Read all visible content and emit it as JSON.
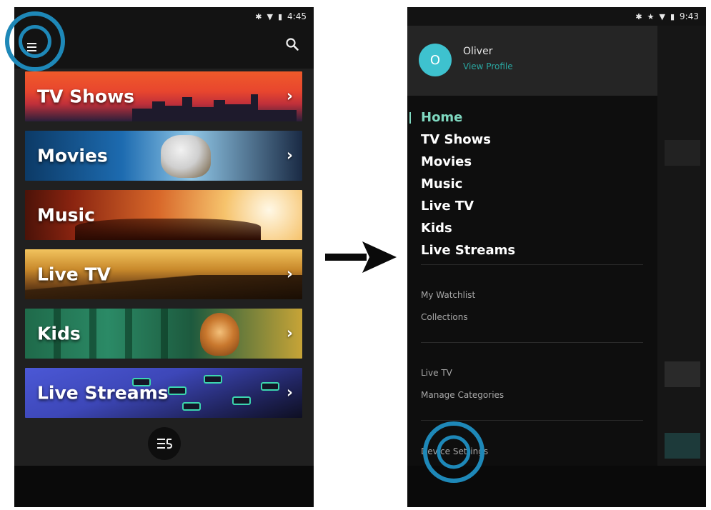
{
  "left_screen": {
    "status": {
      "time": "4:45",
      "icons": [
        "bluetooth-icon",
        "wifi-icon",
        "battery-icon"
      ]
    },
    "app_bar": {
      "icons": [
        "menu-icon",
        "search-icon"
      ]
    },
    "tiles": [
      {
        "label": "TV Shows",
        "chevron": "›"
      },
      {
        "label": "Movies",
        "chevron": "›"
      },
      {
        "label": "Music",
        "chevron": ""
      },
      {
        "label": "Live TV",
        "chevron": "›"
      },
      {
        "label": "Kids",
        "chevron": "›"
      },
      {
        "label": "Live Streams",
        "chevron": "›"
      }
    ],
    "fab_icon": "playlist-icon"
  },
  "right_screen": {
    "status": {
      "time": "9:43",
      "icons": [
        "bluetooth-icon",
        "star-icon",
        "wifi-icon",
        "battery-icon"
      ]
    },
    "profile": {
      "initial": "O",
      "name": "Oliver",
      "link": "View Profile"
    },
    "nav": [
      "Home",
      "TV Shows",
      "Movies",
      "Music",
      "Live TV",
      "Kids",
      "Live Streams"
    ],
    "active_nav": "Home",
    "sections": [
      {
        "items": [
          "My Watchlist",
          "Collections"
        ]
      },
      {
        "items": [
          "Live TV",
          "Manage Categories"
        ]
      },
      {
        "items": [
          "Device Settings"
        ]
      }
    ]
  },
  "colors": {
    "accent": "#7fd8c0",
    "callout": "#1e88b8",
    "avatar": "#3ec2cf"
  }
}
